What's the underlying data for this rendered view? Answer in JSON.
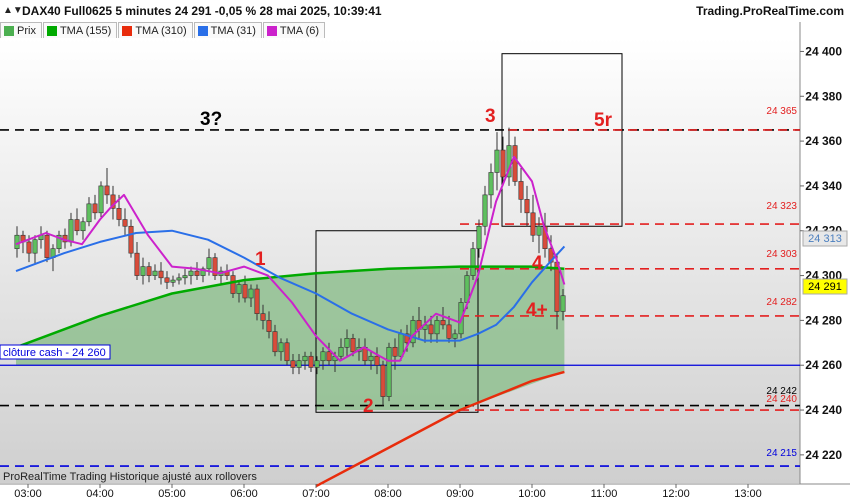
{
  "header": {
    "title": "DAX40 Full0625 5 minutes 24 291 -0,05 % 28 mai 2025, 10:39:41",
    "site": "Trading.ProRealTime.com"
  },
  "legend": [
    {
      "label": "Prix",
      "color": "#4caf50"
    },
    {
      "label": "TMA (155)",
      "color": "#00aa00"
    },
    {
      "label": "TMA (310)",
      "color": "#e82c0c"
    },
    {
      "label": "TMA (31)",
      "color": "#2a6fe8"
    },
    {
      "label": "TMA (6)",
      "color": "#cc22cc"
    }
  ],
  "footer_note": "ProRealTime Trading  Historique ajusté aux rollovers",
  "price_labels": {
    "p24365": "24 365",
    "p24323": "24 323",
    "p24313": "24 313",
    "p24303": "24 303",
    "p24291": "24 291",
    "p24282": "24 282",
    "p24242": "24 242",
    "p24240": "24 240",
    "p24215": "24 215"
  },
  "cash_close_label": "clôture cash -  24 260",
  "annotations": {
    "a1": "1",
    "a2": "2",
    "a3": "3",
    "a3q": "3?",
    "a4": "4",
    "a4p": "4+",
    "a5r": "5r"
  },
  "chart_data": {
    "type": "line",
    "x_ticks": [
      "03:00",
      "04:00",
      "05:00",
      "06:00",
      "07:00",
      "08:00",
      "09:00",
      "10:00",
      "11:00",
      "12:00",
      "13:00"
    ],
    "y_ticks": [
      24400,
      24380,
      24360,
      24340,
      24320,
      24300,
      24280,
      24260,
      24240,
      24220
    ],
    "y_tick_labels": [
      "24 400",
      "24 380",
      "24 360",
      "24 340",
      "24 320",
      "24 300",
      "24 280",
      "24 260",
      "24 240",
      "24 220"
    ],
    "ylim": [
      24207,
      24406
    ],
    "horizontal_levels": [
      {
        "value": 24365,
        "color": "#000000",
        "style": "dashed"
      },
      {
        "value": 24365,
        "color": "#e32020",
        "style": "dashed"
      },
      {
        "value": 24323,
        "color": "#e32020",
        "style": "dashed"
      },
      {
        "value": 24303,
        "color": "#e32020",
        "style": "dashed"
      },
      {
        "value": 24282,
        "color": "#e32020",
        "style": "dashed"
      },
      {
        "value": 24260,
        "color": "#0000dd",
        "style": "solid"
      },
      {
        "value": 24242,
        "color": "#000000",
        "style": "dashed"
      },
      {
        "value": 24240,
        "color": "#e32020",
        "style": "dashed"
      },
      {
        "value": 24215,
        "color": "#0000dd",
        "style": "dashed"
      }
    ],
    "series": [
      {
        "name": "TMA (155)",
        "color": "#00aa00",
        "x": [
          "02:50",
          "04:00",
          "05:00",
          "06:00",
          "07:00",
          "08:00",
          "09:00",
          "10:00",
          "10:27"
        ],
        "values": [
          24268,
          24282,
          24292,
          24298,
          24301,
          24303,
          24304,
          24304,
          24303
        ]
      },
      {
        "name": "TMA (310)",
        "color": "#e82c0c",
        "x": [
          "07:00",
          "08:00",
          "09:00",
          "10:00",
          "10:27"
        ],
        "values": [
          24206,
          24223,
          24240,
          24253,
          24257
        ]
      },
      {
        "name": "TMA (31)",
        "color": "#2a6fe8",
        "x": [
          "02:50",
          "03:30",
          "04:00",
          "04:30",
          "05:00",
          "05:30",
          "06:00",
          "06:30",
          "07:00",
          "07:30",
          "08:00",
          "08:30",
          "09:00",
          "09:15",
          "09:30",
          "09:45",
          "10:00",
          "10:15",
          "10:27"
        ],
        "values": [
          24302,
          24310,
          24315,
          24319,
          24320,
          24316,
          24308,
          24299,
          24292,
          24283,
          24276,
          24271,
          24271,
          24274,
          24278,
          24286,
          24297,
          24306,
          24313
        ]
      },
      {
        "name": "TMA (6)",
        "color": "#cc22cc",
        "x": [
          "02:50",
          "03:15",
          "03:30",
          "03:45",
          "04:00",
          "04:10",
          "04:20",
          "04:40",
          "05:00",
          "05:20",
          "05:40",
          "06:00",
          "06:20",
          "06:40",
          "07:00",
          "07:20",
          "07:40",
          "08:00",
          "08:10",
          "08:20",
          "08:40",
          "09:00",
          "09:15",
          "09:30",
          "09:45",
          "10:00",
          "10:10",
          "10:20",
          "10:27"
        ],
        "values": [
          24314,
          24319,
          24316,
          24314,
          24325,
          24331,
          24336,
          24318,
          24304,
          24303,
          24301,
          24304,
          24300,
          24288,
          24273,
          24262,
          24268,
          24262,
          24262,
          24273,
          24283,
          24279,
          24300,
          24333,
          24353,
          24342,
          24322,
          24308,
          24296
        ]
      }
    ],
    "candles": [
      [
        "02:50",
        24312,
        24322,
        24308,
        24318
      ],
      [
        "02:55",
        24318,
        24320,
        24310,
        24315
      ],
      [
        "03:00",
        24315,
        24318,
        24306,
        24310
      ],
      [
        "03:05",
        24310,
        24318,
        24305,
        24316
      ],
      [
        "03:10",
        24316,
        24322,
        24312,
        24318
      ],
      [
        "03:15",
        24318,
        24320,
        24306,
        24308
      ],
      [
        "03:20",
        24308,
        24314,
        24302,
        24312
      ],
      [
        "03:25",
        24312,
        24320,
        24310,
        24318
      ],
      [
        "03:30",
        24318,
        24321,
        24312,
        24315
      ],
      [
        "03:35",
        24315,
        24328,
        24313,
        24325
      ],
      [
        "03:40",
        24325,
        24330,
        24318,
        24320
      ],
      [
        "03:45",
        24320,
        24326,
        24316,
        24324
      ],
      [
        "03:50",
        24324,
        24335,
        24322,
        24332
      ],
      [
        "03:55",
        24332,
        24336,
        24325,
        24328
      ],
      [
        "04:00",
        24328,
        24342,
        24326,
        24340
      ],
      [
        "04:05",
        24340,
        24348,
        24332,
        24336
      ],
      [
        "04:10",
        24336,
        24340,
        24325,
        24330
      ],
      [
        "04:15",
        24330,
        24336,
        24322,
        24325
      ],
      [
        "04:20",
        24325,
        24330,
        24318,
        24322
      ],
      [
        "04:25",
        24322,
        24325,
        24308,
        24310
      ],
      [
        "04:30",
        24310,
        24315,
        24298,
        24300
      ],
      [
        "04:35",
        24300,
        24308,
        24296,
        24304
      ],
      [
        "04:40",
        24304,
        24306,
        24297,
        24300
      ],
      [
        "04:45",
        24300,
        24305,
        24298,
        24302
      ],
      [
        "04:50",
        24302,
        24306,
        24296,
        24299
      ],
      [
        "04:55",
        24299,
        24302,
        24294,
        24297
      ],
      [
        "05:00",
        24297,
        24300,
        24295,
        24298
      ],
      [
        "05:05",
        24298,
        24301,
        24296,
        24299
      ],
      [
        "05:10",
        24299,
        24303,
        24296,
        24300
      ],
      [
        "05:15",
        24300,
        24304,
        24296,
        24302
      ],
      [
        "05:20",
        24302,
        24306,
        24298,
        24300
      ],
      [
        "05:25",
        24300,
        24304,
        24297,
        24303
      ],
      [
        "05:30",
        24303,
        24312,
        24300,
        24308
      ],
      [
        "05:35",
        24308,
        24310,
        24298,
        24300
      ],
      [
        "05:40",
        24300,
        24304,
        24296,
        24302
      ],
      [
        "05:45",
        24302,
        24305,
        24298,
        24300
      ],
      [
        "05:50",
        24300,
        24302,
        24290,
        24292
      ],
      [
        "05:55",
        24292,
        24298,
        24288,
        24296
      ],
      [
        "06:00",
        24296,
        24300,
        24288,
        24290
      ],
      [
        "06:05",
        24290,
        24296,
        24286,
        24294
      ],
      [
        "06:10",
        24294,
        24296,
        24280,
        24283
      ],
      [
        "06:15",
        24283,
        24287,
        24276,
        24280
      ],
      [
        "06:20",
        24280,
        24284,
        24272,
        24275
      ],
      [
        "06:25",
        24275,
        24278,
        24264,
        24266
      ],
      [
        "06:30",
        24266,
        24272,
        24262,
        24270
      ],
      [
        "06:35",
        24270,
        24272,
        24260,
        24262
      ],
      [
        "06:40",
        24262,
        24265,
        24256,
        24259
      ],
      [
        "06:45",
        24259,
        24265,
        24256,
        24262
      ],
      [
        "06:50",
        24262,
        24266,
        24258,
        24264
      ],
      [
        "06:55",
        24264,
        24266,
        24257,
        24259
      ],
      [
        "07:00",
        24259,
        24264,
        24256,
        24262
      ],
      [
        "07:05",
        24262,
        24268,
        24258,
        24266
      ],
      [
        "07:10",
        24266,
        24270,
        24260,
        24262
      ],
      [
        "07:15",
        24262,
        24266,
        24257,
        24264
      ],
      [
        "07:20",
        24264,
        24272,
        24262,
        24268
      ],
      [
        "07:25",
        24268,
        24276,
        24264,
        24272
      ],
      [
        "07:30",
        24272,
        24274,
        24264,
        24266
      ],
      [
        "07:35",
        24266,
        24272,
        24262,
        24268
      ],
      [
        "07:40",
        24268,
        24272,
        24260,
        24262
      ],
      [
        "07:45",
        24262,
        24266,
        24258,
        24264
      ],
      [
        "07:50",
        24264,
        24268,
        24256,
        24260
      ],
      [
        "07:55",
        24260,
        24262,
        24242,
        24246
      ],
      [
        "08:00",
        24246,
        24270,
        24244,
        24268
      ],
      [
        "08:05",
        24268,
        24272,
        24258,
        24264
      ],
      [
        "08:10",
        24264,
        24276,
        24262,
        24274
      ],
      [
        "08:15",
        24274,
        24278,
        24266,
        24270
      ],
      [
        "08:20",
        24270,
        24282,
        24268,
        24280
      ],
      [
        "08:25",
        24280,
        24286,
        24272,
        24276
      ],
      [
        "08:30",
        24276,
        24282,
        24270,
        24278
      ],
      [
        "08:35",
        24278,
        24282,
        24270,
        24274
      ],
      [
        "08:40",
        24274,
        24282,
        24270,
        24280
      ],
      [
        "08:45",
        24280,
        24286,
        24276,
        24278
      ],
      [
        "08:50",
        24278,
        24282,
        24270,
        24272
      ],
      [
        "08:55",
        24272,
        24276,
        24268,
        24274
      ],
      [
        "09:00",
        24274,
        24290,
        24272,
        24288
      ],
      [
        "09:05",
        24288,
        24302,
        24285,
        24300
      ],
      [
        "09:10",
        24300,
        24315,
        24298,
        24312
      ],
      [
        "09:15",
        24312,
        24325,
        24308,
        24322
      ],
      [
        "09:20",
        24322,
        24340,
        24318,
        24336
      ],
      [
        "09:25",
        24336,
        24350,
        24330,
        24346
      ],
      [
        "09:30",
        24346,
        24364,
        24338,
        24356
      ],
      [
        "09:35",
        24356,
        24362,
        24340,
        24344
      ],
      [
        "09:40",
        24344,
        24366,
        24340,
        24358
      ],
      [
        "09:45",
        24358,
        24362,
        24340,
        24342
      ],
      [
        "09:50",
        24342,
        24348,
        24328,
        24334
      ],
      [
        "09:55",
        24334,
        24340,
        24322,
        24328
      ],
      [
        "10:00",
        24328,
        24336,
        24315,
        24318
      ],
      [
        "10:05",
        24318,
        24326,
        24310,
        24322
      ],
      [
        "10:10",
        24322,
        24328,
        24308,
        24312
      ],
      [
        "10:15",
        24312,
        24318,
        24302,
        24306
      ],
      [
        "10:20",
        24306,
        24310,
        24276,
        24284
      ],
      [
        "10:25",
        24284,
        24294,
        24280,
        24291
      ]
    ]
  }
}
